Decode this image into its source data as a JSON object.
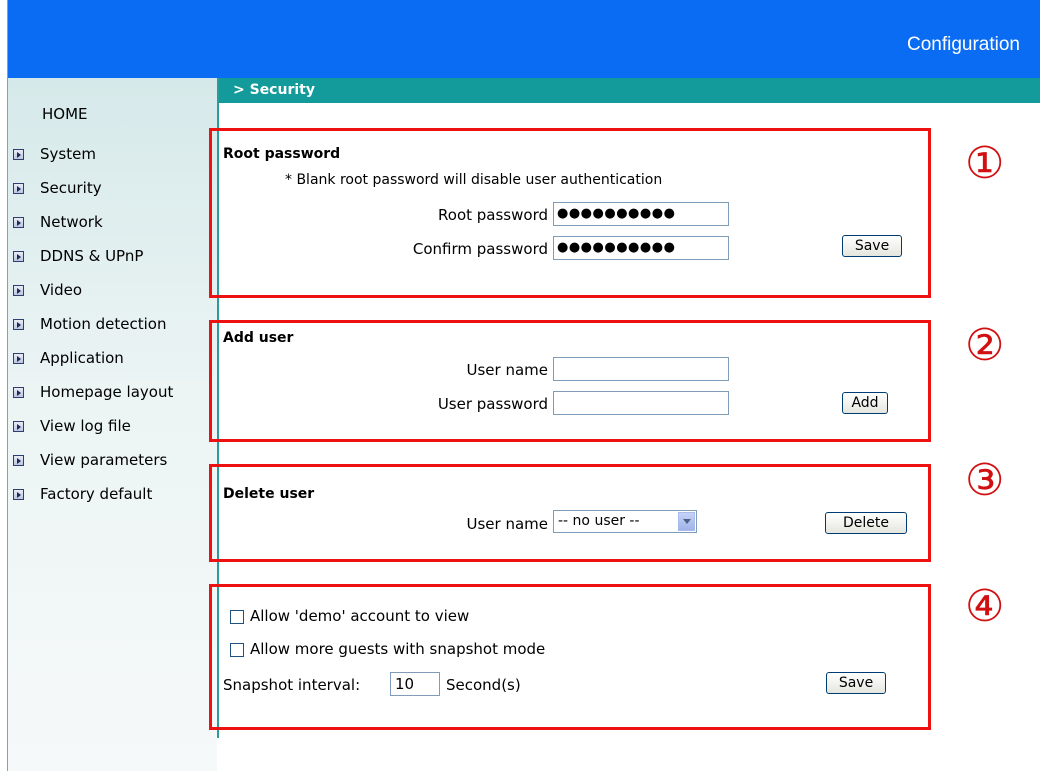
{
  "header": {
    "title": "Configuration"
  },
  "breadcrumb": "> Security",
  "sidebar": {
    "home": "HOME",
    "items": [
      {
        "label": "System"
      },
      {
        "label": "Security"
      },
      {
        "label": "Network"
      },
      {
        "label": "DDNS & UPnP"
      },
      {
        "label": "Video"
      },
      {
        "label": "Motion detection"
      },
      {
        "label": "Application"
      },
      {
        "label": "Homepage layout"
      },
      {
        "label": "View log file"
      },
      {
        "label": "View parameters"
      },
      {
        "label": "Factory default"
      }
    ]
  },
  "root_password": {
    "title": "Root password",
    "note": "* Blank root password will disable user authentication",
    "password_label": "Root password",
    "password_value": "●●●●●●●●●●",
    "confirm_label": "Confirm password",
    "confirm_value": "●●●●●●●●●●",
    "save_label": "Save"
  },
  "add_user": {
    "title": "Add user",
    "username_label": "User name",
    "username_value": "",
    "password_label": "User password",
    "password_value": "",
    "add_label": "Add"
  },
  "delete_user": {
    "title": "Delete user",
    "username_label": "User name",
    "selected": "-- no user --",
    "delete_label": "Delete"
  },
  "guest": {
    "demo_label": "Allow 'demo' account to view",
    "demo_checked": false,
    "snapshot_label": "Allow more guests with snapshot mode",
    "snapshot_checked": false,
    "interval_label": "Snapshot interval:",
    "interval_value": "10",
    "interval_unit": "Second(s)",
    "save_label": "Save"
  },
  "annotations": [
    "①",
    "②",
    "③",
    "④"
  ],
  "colors": {
    "header": "#0a6cf2",
    "section_bar": "#139a9a",
    "highlight": "#ee1111"
  }
}
